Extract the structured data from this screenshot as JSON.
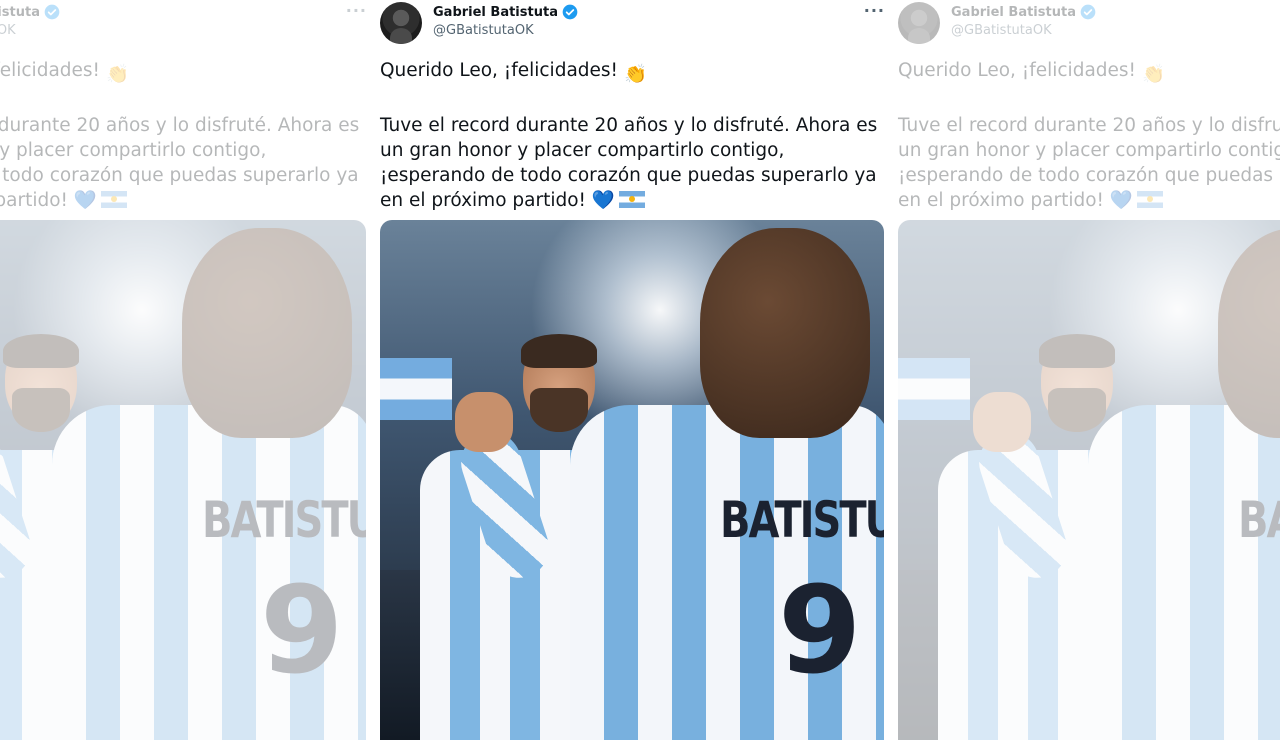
{
  "tweet": {
    "author_name": "Gabriel Batistuta",
    "author_handle": "@GBatistutaOK",
    "more_label": "···",
    "paragraph1": "Querido Leo, ¡felicidades!",
    "paragraph2": "Tuve el record durante 20 años y lo disfruté. Ahora es un gran honor y placer compartirlo contigo, ¡esperando de todo corazón que puedas superarlo ya en el próximo partido!",
    "emoji_clap": "👏",
    "emoji_heart": "💙",
    "icons": [
      "verified-icon",
      "more-icon",
      "clap-emoji-icon",
      "blue-heart-icon",
      "argentina-flag-icon"
    ]
  },
  "media": {
    "jersey_name": "BATISTUTA",
    "jersey_number": "9"
  },
  "colors": {
    "verified": "#1d9bf0",
    "text": "#0f1419",
    "secondary": "#536471",
    "argentina_blue": "#74acdf"
  }
}
